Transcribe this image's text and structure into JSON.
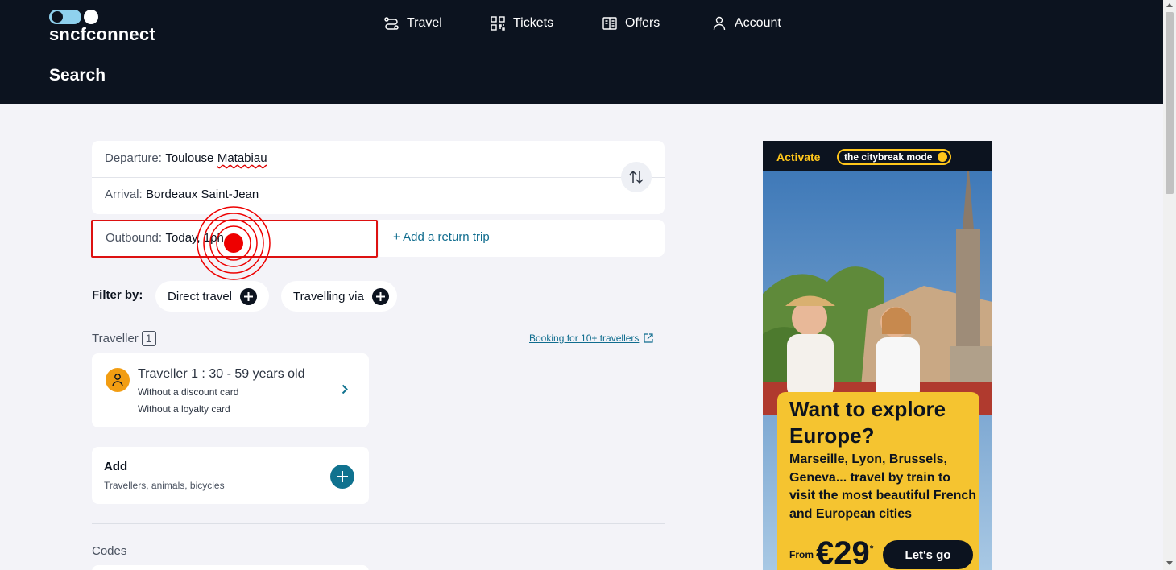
{
  "brand": {
    "logo_text_1": "sncf",
    "logo_text_2": "connect"
  },
  "nav": [
    {
      "label": "Travel",
      "icon": "route-icon"
    },
    {
      "label": "Tickets",
      "icon": "qr-code-icon"
    },
    {
      "label": "Offers",
      "icon": "brochure-icon"
    },
    {
      "label": "Account",
      "icon": "user-icon"
    }
  ],
  "page": {
    "title": "Search"
  },
  "search": {
    "departure_label": "Departure:",
    "departure_value_1": "Toulouse",
    "departure_value_2": "Matabiau",
    "arrival_label": "Arrival:",
    "arrival_value": "Bordeaux Saint-Jean",
    "outbound_label": "Outbound:",
    "outbound_value": "Today, 1ph",
    "return_link": "+ Add a return trip"
  },
  "filter": {
    "label": "Filter by:",
    "chips": [
      "Direct travel",
      "Travelling via"
    ]
  },
  "travellers": {
    "heading": "Traveller",
    "count": "1",
    "booking_link": "Booking for 10+ travellers",
    "items": [
      {
        "name": "Traveller 1 :  30 - 59 years old",
        "discount": "Without a discount card",
        "loyalty": "Without a loyalty card"
      }
    ]
  },
  "add": {
    "title": "Add",
    "subtitle": "Travellers, animals, bicycles"
  },
  "codes": {
    "heading": "Codes"
  },
  "ad": {
    "activate": "Activate",
    "pill": "the citybreak mode",
    "headline": "Want to explore Europe?",
    "body": "Marseille, Lyon, Brussels, Geneva... travel by train to visit the most beautiful French and European cities",
    "from": "From",
    "price": "€29",
    "price_suffix": "*",
    "cta": "Let's go"
  },
  "colors": {
    "header_bg": "#0c131f",
    "accent": "#10728f",
    "ad_yellow": "#f5c430",
    "focus_red": "#d11111"
  }
}
